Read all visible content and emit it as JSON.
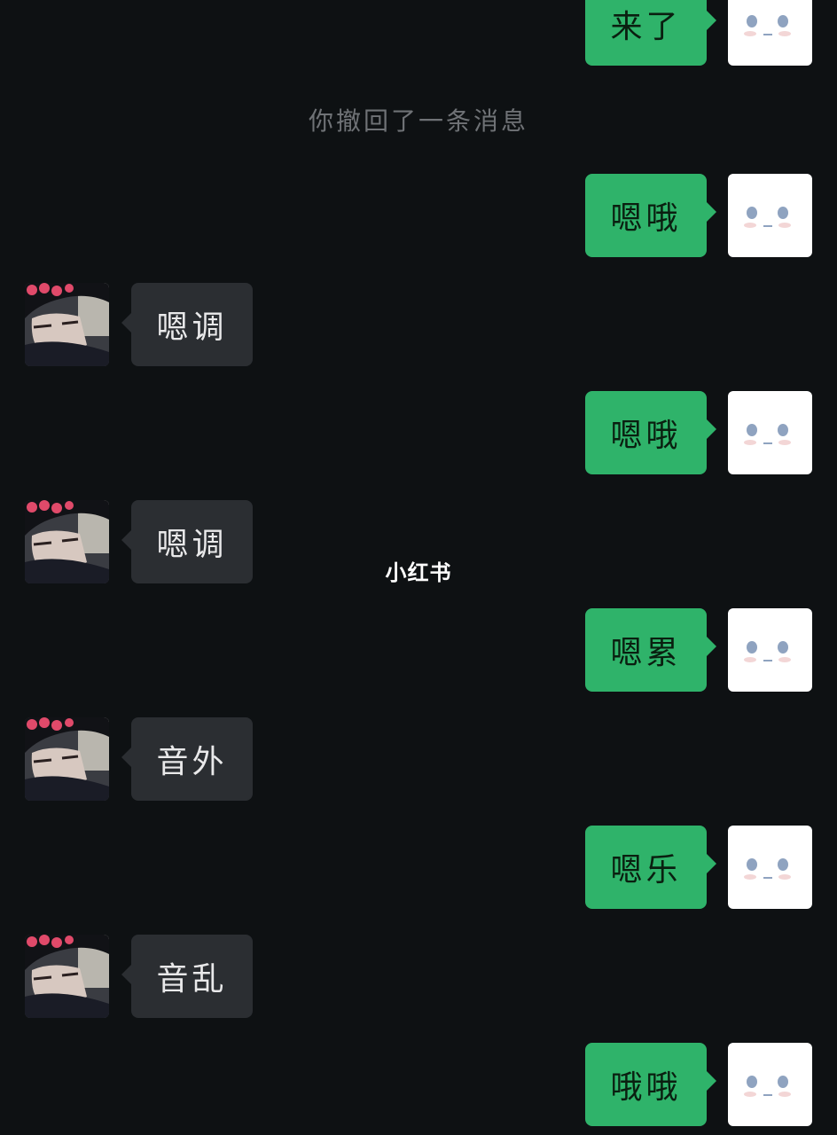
{
  "system_note": "你撤回了一条消息",
  "watermark": "小红书",
  "colors": {
    "background": "#0e1113",
    "self_bubble": "#2fb36a",
    "other_bubble": "#2b2e32",
    "self_avatar": "#ffffff"
  },
  "messages": [
    {
      "sender": "self",
      "text": "来了"
    },
    {
      "sender": "self",
      "text": "嗯哦"
    },
    {
      "sender": "other",
      "text": "嗯调"
    },
    {
      "sender": "self",
      "text": "嗯哦"
    },
    {
      "sender": "other",
      "text": "嗯调"
    },
    {
      "sender": "self",
      "text": "嗯累"
    },
    {
      "sender": "other",
      "text": "音外"
    },
    {
      "sender": "self",
      "text": "嗯乐"
    },
    {
      "sender": "other",
      "text": "音乱"
    },
    {
      "sender": "self",
      "text": "哦哦"
    }
  ]
}
